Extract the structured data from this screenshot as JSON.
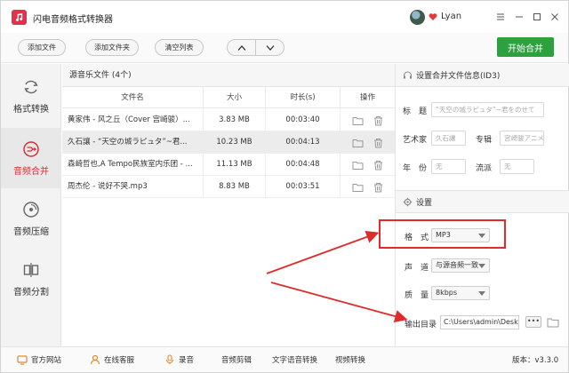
{
  "app": {
    "title": "闪电音频格式转换器",
    "username": "Lyan"
  },
  "toolbar": {
    "add_file": "添加文件",
    "add_folder": "添加文件夹",
    "clear_list": "清空列表",
    "start_merge": "开始合并"
  },
  "sidebar": {
    "items": [
      {
        "label": "格式转换",
        "icon": "refresh-icon"
      },
      {
        "label": "音频合并",
        "icon": "merge-icon"
      },
      {
        "label": "音频压缩",
        "icon": "disc-icon"
      },
      {
        "label": "音频分割",
        "icon": "split-icon"
      }
    ]
  },
  "filelist": {
    "header": "源音乐文件 (4个)",
    "columns": [
      "文件名",
      "大小",
      "时长(s)",
      "操作"
    ],
    "rows": [
      {
        "name": "黄家伟 - 风之丘（Cover 宫崎骏）...",
        "size": "3.83 MB",
        "duration": "00:03:40"
      },
      {
        "name": "久石讓 - “天空の城ラピュタ”~君...",
        "size": "10.23 MB",
        "duration": "00:04:13"
      },
      {
        "name": "森崎哲也,A Tempo民族室内乐团 - ...",
        "size": "11.13 MB",
        "duration": "00:04:48"
      },
      {
        "name": "周杰伦 - 说好不哭.mp3",
        "size": "8.83 MB",
        "duration": "00:03:51"
      }
    ]
  },
  "id3": {
    "header": "设置合并文件信息(ID3)",
    "title_label": "标　题",
    "title_placeholder": "“天空の城ラピュタ”~君をのせて",
    "artist_label": "艺术家",
    "artist_value": "久石讓",
    "album_label": "专辑",
    "album_value": "宫崎骏アニメ...",
    "year_label": "年　份",
    "year_value": "无",
    "genre_label": "流派",
    "genre_value": "无"
  },
  "settings": {
    "header": "设置",
    "format_label": "格　式",
    "format_value": "MP3",
    "channel_label": "声　道",
    "channel_value": "与源音频一致",
    "quality_label": "质　量",
    "quality_value": "8kbps",
    "output_label": "输出目录",
    "output_value": "C:\\Users\\admin\\Desktc",
    "dots_label": "•••"
  },
  "statusbar": {
    "items": [
      {
        "label": "官方网站",
        "icon": "home-icon"
      },
      {
        "label": "在线客服",
        "icon": "support-icon"
      },
      {
        "label": "录音",
        "icon": "mic-icon"
      },
      {
        "label": "音频剪辑",
        "icon": "clip-icon"
      },
      {
        "label": "文字语音转换",
        "icon": "text-icon"
      },
      {
        "label": "视频转换",
        "icon": "video-icon"
      }
    ],
    "version": "版本：v3.3.0"
  },
  "colors": {
    "accent_red": "#d92e3a",
    "start_green": "#2da13d",
    "annotation_red": "#e02b2b"
  }
}
